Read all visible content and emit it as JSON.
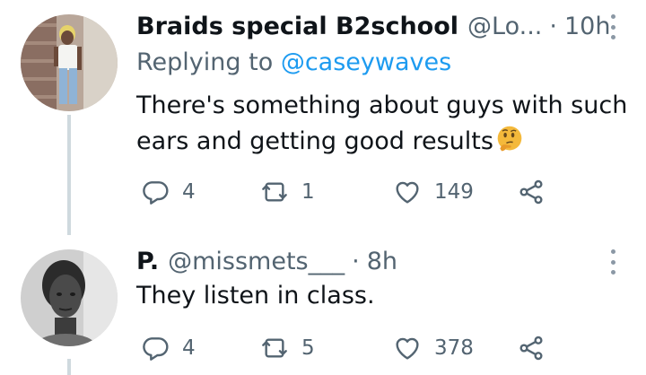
{
  "colors": {
    "primary_text": "#0f1419",
    "secondary_text": "#536471",
    "link": "#1d9bf0",
    "thread_line": "#cfd9de"
  },
  "tweets": [
    {
      "name": "Braids special B2school",
      "handle": "@Lo...",
      "separator": "·",
      "time": "10h",
      "replying_prefix": "Replying to",
      "replying_to": "@caseywaves",
      "text": "There's something about guys with such ears and getting good results",
      "emoji": "thinking-face-icon",
      "replies": "4",
      "retweets": "1",
      "likes": "149"
    },
    {
      "name": "P.",
      "handle": "@missmets___",
      "separator": "·",
      "time": "8h",
      "text": "They listen in class.",
      "replies": "4",
      "retweets": "5",
      "likes": "378"
    }
  ]
}
